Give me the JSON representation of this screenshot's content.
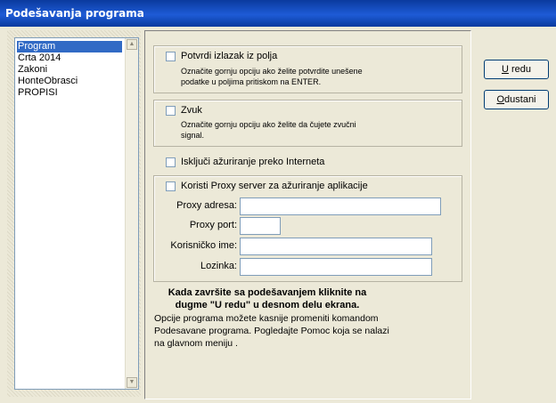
{
  "window": {
    "title": "Podešavanja programa"
  },
  "list": {
    "items": [
      "Program",
      "Crta 2014",
      "Zakoni",
      "HonteObrasci",
      "PROPISI"
    ]
  },
  "options": {
    "confirm_exit": {
      "label": "Potvrdi izlazak iz polja",
      "note_line1": "Označite gornju opciju ako želite potvrdite unešene",
      "note_line2": "podatke u poljima pritiskom na ENTER."
    },
    "sound": {
      "label": "Zvuk",
      "note_line1": "Označite gornju opciju ako želite da čujete zvučni",
      "note_line2": "signal."
    },
    "disable_update": {
      "label": "Isključi ažuriranje preko Interneta"
    },
    "proxy": {
      "label": "Koristi Proxy server za ažuriranje aplikacije"
    }
  },
  "proxy_fields": {
    "address_label": "Proxy adresa:",
    "port_label": "Proxy port:",
    "username_label": "Korisničko ime:",
    "password_label": "Lozinka:"
  },
  "message": {
    "bold_line1": "Kada završite sa podešavanjem kliknite na",
    "bold_line2": "dugme \"U redu\" u desnom delu ekrana.",
    "line1": "Opcije programa možete kasnije promeniti komandom",
    "line2": "Podesavane programa. Pogledajte Pomoc koja se nalazi",
    "line3": "na glavnom meniju ."
  },
  "buttons": {
    "ok_mnemonic": "U",
    "ok_rest": " redu",
    "cancel_mnemonic": "O",
    "cancel_rest": "dustani"
  }
}
